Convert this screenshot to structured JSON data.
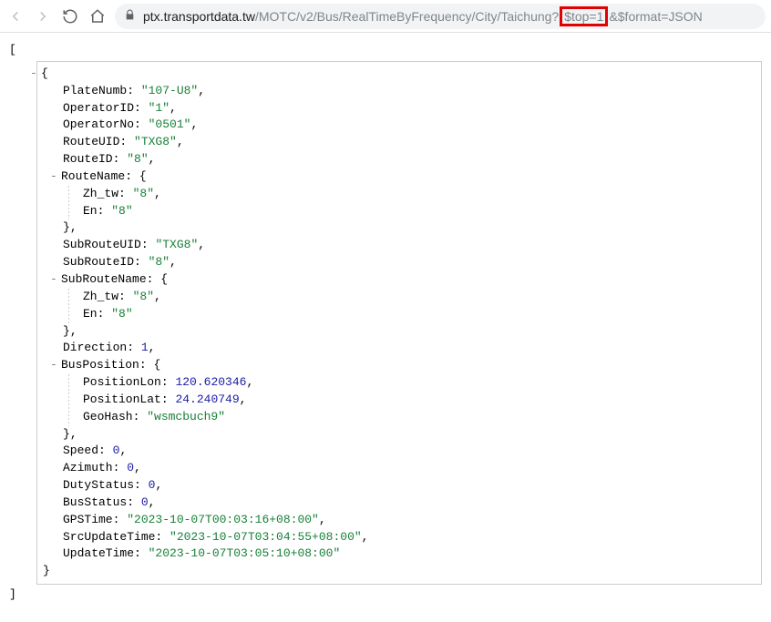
{
  "toolbar": {
    "url_host": "ptx.transportdata.tw",
    "url_path_before": "/MOTC/v2/Bus/RealTimeByFrequency/City/Taichung?",
    "url_highlight": "$top=1",
    "url_path_after": "&$format=JSON"
  },
  "json_view": {
    "open_bracket": "[",
    "close_bracket": "]",
    "toggle_minus": "-",
    "obj_open": "{",
    "obj_close": "}",
    "comma": ",",
    "colon_sp": ": ",
    "fields": {
      "PlateNumb": {
        "key": "PlateNumb",
        "val": "\"107-U8\"",
        "type": "str"
      },
      "OperatorID": {
        "key": "OperatorID",
        "val": "\"1\"",
        "type": "str"
      },
      "OperatorNo": {
        "key": "OperatorNo",
        "val": "\"0501\"",
        "type": "str"
      },
      "RouteUID": {
        "key": "RouteUID",
        "val": "\"TXG8\"",
        "type": "str"
      },
      "RouteID": {
        "key": "RouteID",
        "val": "\"8\"",
        "type": "str"
      },
      "RouteName": {
        "key": "RouteName"
      },
      "RouteName_Zh": {
        "key": "Zh_tw",
        "val": "\"8\"",
        "type": "str"
      },
      "RouteName_En": {
        "key": "En",
        "val": "\"8\"",
        "type": "str"
      },
      "SubRouteUID": {
        "key": "SubRouteUID",
        "val": "\"TXG8\"",
        "type": "str"
      },
      "SubRouteID": {
        "key": "SubRouteID",
        "val": "\"8\"",
        "type": "str"
      },
      "SubRouteName": {
        "key": "SubRouteName"
      },
      "SubRouteName_Zh": {
        "key": "Zh_tw",
        "val": "\"8\"",
        "type": "str"
      },
      "SubRouteName_En": {
        "key": "En",
        "val": "\"8\"",
        "type": "str"
      },
      "Direction": {
        "key": "Direction",
        "val": "1",
        "type": "num"
      },
      "BusPosition": {
        "key": "BusPosition"
      },
      "PositionLon": {
        "key": "PositionLon",
        "val": "120.620346",
        "type": "num"
      },
      "PositionLat": {
        "key": "PositionLat",
        "val": "24.240749",
        "type": "num"
      },
      "GeoHash": {
        "key": "GeoHash",
        "val": "\"wsmcbuch9\"",
        "type": "str"
      },
      "Speed": {
        "key": "Speed",
        "val": "0",
        "type": "num"
      },
      "Azimuth": {
        "key": "Azimuth",
        "val": "0",
        "type": "num"
      },
      "DutyStatus": {
        "key": "DutyStatus",
        "val": "0",
        "type": "num"
      },
      "BusStatus": {
        "key": "BusStatus",
        "val": "0",
        "type": "num"
      },
      "GPSTime": {
        "key": "GPSTime",
        "val": "\"2023-10-07T00:03:16+08:00\"",
        "type": "str"
      },
      "SrcUpdateTime": {
        "key": "SrcUpdateTime",
        "val": "\"2023-10-07T03:04:55+08:00\"",
        "type": "str"
      },
      "UpdateTime": {
        "key": "UpdateTime",
        "val": "\"2023-10-07T03:05:10+08:00\"",
        "type": "str"
      }
    }
  }
}
